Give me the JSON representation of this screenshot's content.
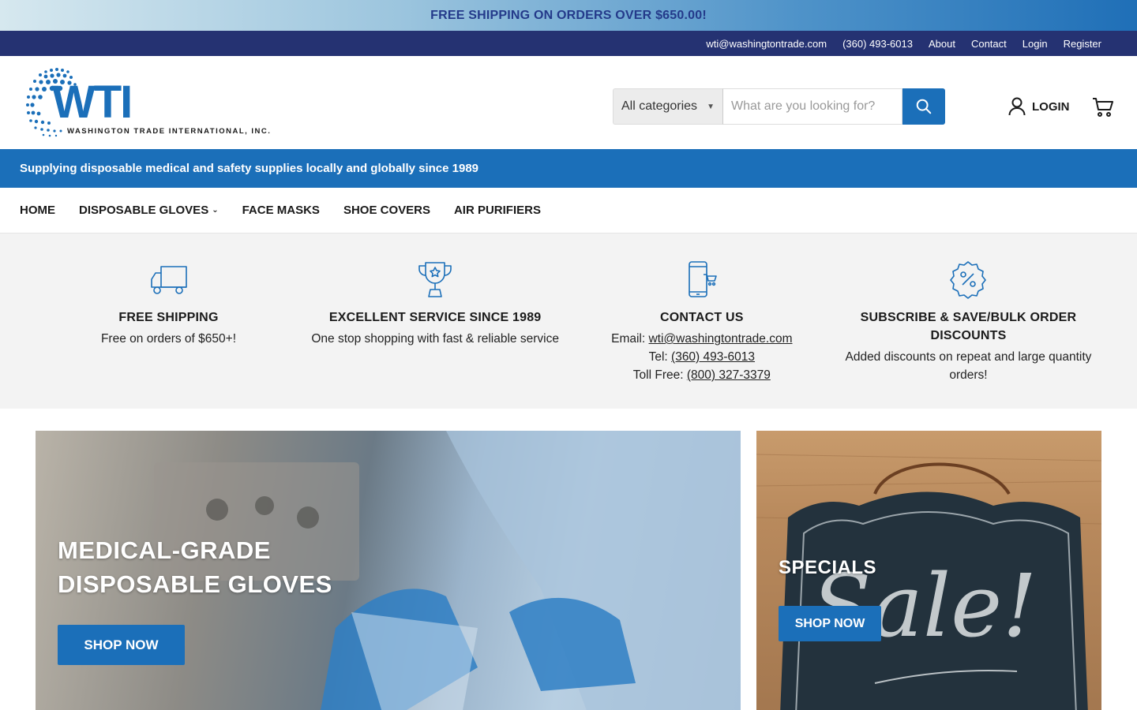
{
  "promo": {
    "text": "FREE SHIPPING ON ORDERS OVER $650.00!"
  },
  "utility": {
    "email": "wti@washingtontrade.com",
    "phone": "(360) 493-6013",
    "about": "About",
    "contact": "Contact",
    "login": "Login",
    "register": "Register"
  },
  "logo": {
    "wordmark": "WTI",
    "company": "WASHINGTON TRADE INTERNATIONAL, INC."
  },
  "search": {
    "category": "All categories",
    "placeholder": "What are you looking for?"
  },
  "header": {
    "login_label": "LOGIN"
  },
  "tagline": "Supplying disposable medical and safety supplies locally and globally since 1989",
  "nav": {
    "home": "HOME",
    "gloves": "DISPOSABLE GLOVES",
    "masks": "FACE MASKS",
    "covers": "SHOE COVERS",
    "purifiers": "AIR PURIFIERS"
  },
  "features": {
    "shipping": {
      "title": "FREE SHIPPING",
      "text": "Free on orders of $650+!"
    },
    "service": {
      "title": "EXCELLENT SERVICE SINCE 1989",
      "text": "One stop shopping with fast & reliable service"
    },
    "contact": {
      "title": "CONTACT US",
      "email_label": "Email: ",
      "email": "wti@washingtontrade.com",
      "tel_label": "Tel: ",
      "tel": "(360) 493-6013",
      "tollfree_label": "Toll Free: ",
      "tollfree": "(800) 327-3379"
    },
    "discounts": {
      "title": "SUBSCRIBE & SAVE/BULK ORDER DISCOUNTS",
      "text": "Added discounts on repeat and large quantity orders!"
    }
  },
  "banners": {
    "gloves": {
      "title_line1": "MEDICAL-GRADE",
      "title_line2": "DISPOSABLE GLOVES",
      "button": "SHOP NOW"
    },
    "specials": {
      "title": "SPECIALS",
      "button": "SHOP NOW"
    }
  },
  "colors": {
    "brand_blue": "#1b6fb9",
    "navy": "#253272",
    "promo_text": "#243a8a"
  }
}
